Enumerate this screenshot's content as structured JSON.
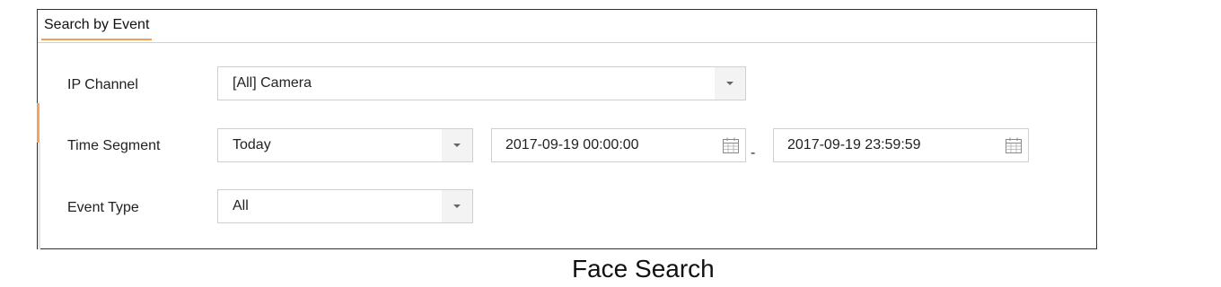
{
  "tab": {
    "label": "Search by Event"
  },
  "fields": {
    "ip_channel": {
      "label": "IP Channel",
      "value": "[All] Camera"
    },
    "time_segment": {
      "label": "Time Segment",
      "value": "Today",
      "start": "2017-09-19 00:00:00",
      "separator": "-",
      "end": "2017-09-19 23:59:59"
    },
    "event_type": {
      "label": "Event Type",
      "value": "All"
    }
  },
  "caption": "Face Search",
  "colors": {
    "accent": "#f0a050",
    "border": "#cfcfcf",
    "dropdown_bg": "#f3f3f3"
  },
  "icons": {
    "dropdown": "chevron-down-icon",
    "calendar": "calendar-icon"
  }
}
